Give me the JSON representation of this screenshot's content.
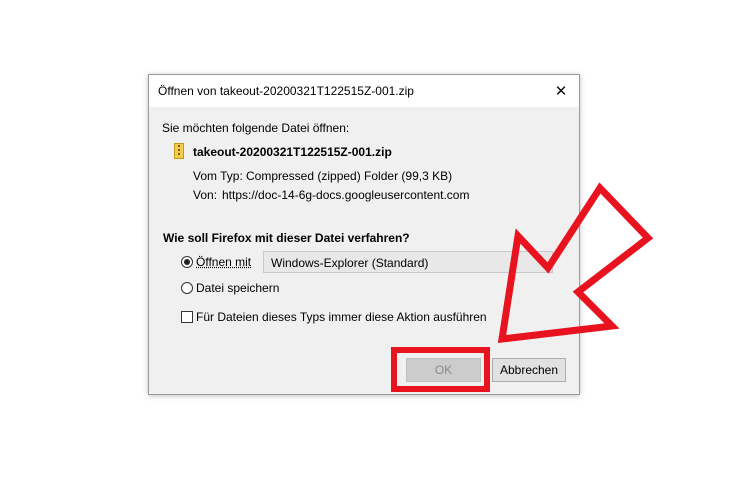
{
  "dialog": {
    "title": "Öffnen von takeout-20200321T122515Z-001.zip",
    "close_glyph": "✕",
    "intro": "Sie möchten folgende Datei öffnen:",
    "file_name": "takeout-20200321T122515Z-001.zip",
    "file_icon": "zip-file-icon",
    "type_label": "Vom Typ:",
    "type_value": "Compressed (zipped) Folder (99,3 KB)",
    "from_label": "Von:",
    "from_value": "https://doc-14-6g-docs.googleusercontent.com",
    "question": "Wie soll Firefox mit dieser Datei verfahren?",
    "open_with_label": "Öffnen mit",
    "open_with_selected": "Windows-Explorer (Standard)",
    "open_with_checked": true,
    "save_label": "Datei speichern",
    "save_checked": false,
    "always_label": "Für Dateien dieses Typs immer diese Aktion ausführen",
    "always_checked": false,
    "ok_label": "OK",
    "cancel_label": "Abbrechen"
  },
  "annotation": {
    "highlight_color": "#e8131f"
  }
}
